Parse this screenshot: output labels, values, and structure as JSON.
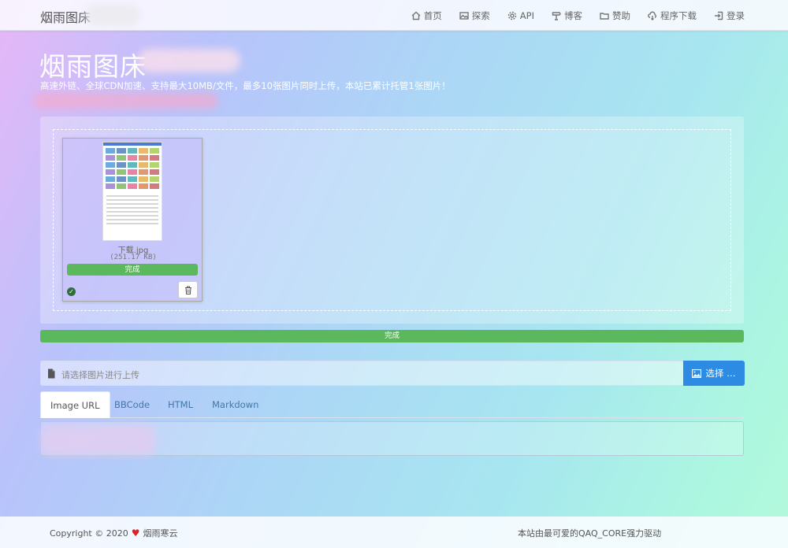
{
  "navbar": {
    "brand": "烟雨图床",
    "items": [
      {
        "label": "首页",
        "icon": "home-icon"
      },
      {
        "label": "探索",
        "icon": "image-icon"
      },
      {
        "label": "API",
        "icon": "gear-icon"
      },
      {
        "label": "博客",
        "icon": "signpost-icon"
      },
      {
        "label": "赞助",
        "icon": "folder-icon"
      },
      {
        "label": "程序下载",
        "icon": "cloud-download-icon"
      },
      {
        "label": "登录",
        "icon": "login-icon"
      }
    ]
  },
  "hero": {
    "title": "烟雨图床",
    "subtitle": "高速外链、全球CDN加速、支持最大10MB/文件，最多10张图片同时上传，本站已累计托管1张图片！"
  },
  "upload": {
    "file_name": "下载.jpg",
    "file_size": "(251.17 KB)",
    "file_status": "完成",
    "file_progress": 1.0,
    "overall_status": "完成",
    "overall_progress": 1.0
  },
  "file_input": {
    "placeholder": "请选择图片进行上传",
    "button_label": "选择 …"
  },
  "tabs": [
    {
      "label": "Image URL",
      "active": true
    },
    {
      "label": "BBCode",
      "active": false
    },
    {
      "label": "HTML",
      "active": false
    },
    {
      "label": "Markdown",
      "active": false
    }
  ],
  "footer": {
    "copyright_prefix": "Copyright © 2020",
    "copyright_name": "烟雨寒云",
    "powered_by": "本站由最可爱的QAQ_CORE强力驱动"
  },
  "colors": {
    "success": "#5cb85c",
    "primary": "#2d8be3",
    "heart": "#d9242a"
  }
}
